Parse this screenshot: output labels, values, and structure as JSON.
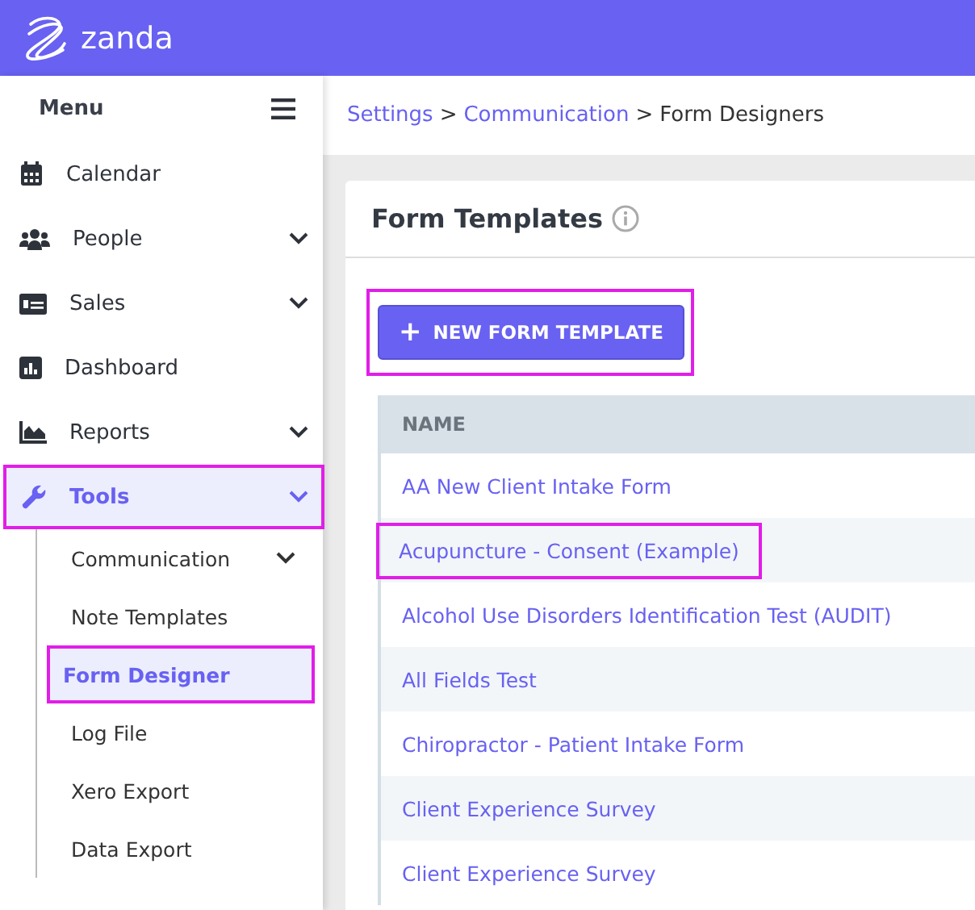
{
  "header": {
    "brand": "zanda"
  },
  "sidebar": {
    "title": "Menu",
    "items": [
      {
        "label": "Calendar",
        "kind": "calendar",
        "expandable": false,
        "selected": false,
        "highlighted": false
      },
      {
        "label": "People",
        "kind": "people",
        "expandable": true,
        "selected": false,
        "highlighted": false
      },
      {
        "label": "Sales",
        "kind": "sales",
        "expandable": true,
        "selected": false,
        "highlighted": false
      },
      {
        "label": "Dashboard",
        "kind": "dashboard",
        "expandable": false,
        "selected": false,
        "highlighted": false
      },
      {
        "label": "Reports",
        "kind": "reports",
        "expandable": true,
        "selected": false,
        "highlighted": false
      },
      {
        "label": "Tools",
        "kind": "tools",
        "expandable": true,
        "selected": true,
        "highlighted": true,
        "children": [
          {
            "label": "Communication",
            "expandable": true,
            "selected": false,
            "highlighted": false
          },
          {
            "label": "Note Templates",
            "expandable": false,
            "selected": false,
            "highlighted": false
          },
          {
            "label": "Form Designer",
            "expandable": false,
            "selected": true,
            "highlighted": true
          },
          {
            "label": "Log File",
            "expandable": false,
            "selected": false,
            "highlighted": false
          },
          {
            "label": "Xero Export",
            "expandable": false,
            "selected": false,
            "highlighted": false
          },
          {
            "label": "Data Export",
            "expandable": false,
            "selected": false,
            "highlighted": false
          }
        ]
      }
    ]
  },
  "breadcrumb": [
    {
      "label": "Settings",
      "link": true
    },
    {
      "label": ">",
      "link": false
    },
    {
      "label": "Communication",
      "link": true
    },
    {
      "label": ">",
      "link": false
    },
    {
      "label": "Form Designers",
      "link": false
    }
  ],
  "card": {
    "title": "Form Templates",
    "button": {
      "icon": "+",
      "label": "NEW FORM TEMPLATE",
      "highlighted": true
    },
    "table": {
      "columns": [
        "NAME"
      ],
      "rows": [
        {
          "name": "AA New Client Intake Form",
          "highlighted": false
        },
        {
          "name": "Acupuncture - Consent (Example)",
          "highlighted": true
        },
        {
          "name": "Alcohol Use Disorders Identification Test (AUDIT)",
          "highlighted": false
        },
        {
          "name": "All Fields Test",
          "highlighted": false
        },
        {
          "name": "Chiropractor - Patient Intake Form",
          "highlighted": false
        },
        {
          "name": "Client Experience Survey",
          "highlighted": false
        },
        {
          "name": "Client Experience Survey",
          "highlighted": false
        }
      ]
    }
  }
}
